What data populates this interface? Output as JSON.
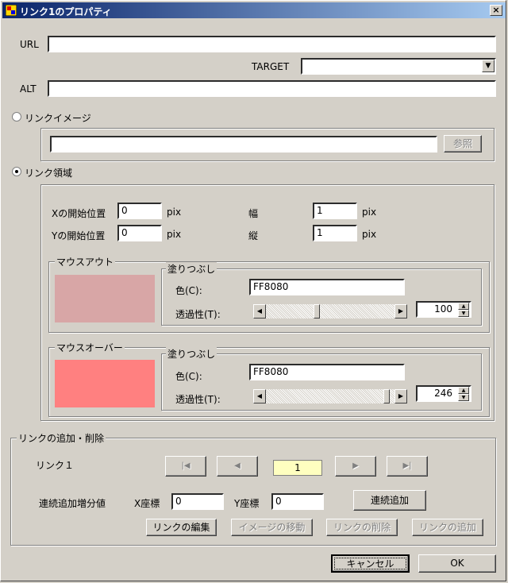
{
  "window": {
    "title": "リンク1のプロパティ",
    "close_glyph": "×"
  },
  "url": {
    "label": "URL",
    "value": ""
  },
  "target": {
    "label": "TARGET",
    "value": ""
  },
  "alt": {
    "label": "ALT",
    "value": ""
  },
  "link_image": {
    "radio_label": "リンクイメージ",
    "path": "",
    "browse_button": "参照"
  },
  "link_area": {
    "radio_label": "リンク領域",
    "x_label": "Xの開始位置",
    "x_value": "0",
    "x_unit": "pix",
    "y_label": "Yの開始位置",
    "y_value": "0",
    "y_unit": "pix",
    "w_label": "幅",
    "w_value": "1",
    "w_unit": "pix",
    "h_label": "縦",
    "h_value": "1",
    "h_unit": "pix"
  },
  "mouse_out": {
    "group_label": "マウスアウト",
    "fill_label": "塗りつぶし",
    "color_label": "色(C):",
    "color_value": "FF8080",
    "preview_color": "#d8a6a6",
    "opacity_label": "透過性(T):",
    "opacity_value": "100",
    "opacity_fraction": 0.39
  },
  "mouse_over": {
    "group_label": "マウスオーバー",
    "fill_label": "塗りつぶし",
    "color_label": "色(C):",
    "color_value": "FF8080",
    "preview_color": "#ff8080",
    "opacity_label": "透過性(T):",
    "opacity_value": "246",
    "opacity_fraction": 0.96
  },
  "links": {
    "group_label": "リンクの追加・削除",
    "link_label": "リンク１",
    "nav_first": "|◀",
    "nav_prev": "◀",
    "nav_next": "▶",
    "nav_last": "▶|",
    "current": "1",
    "increment_label": "連続追加増分値",
    "x_label": "X座標",
    "x_value": "0",
    "y_label": "Y座標",
    "y_value": "0",
    "continuous_add": "連続追加",
    "edit": "リンクの編集",
    "move_image": "イメージの移動",
    "delete": "リンクの削除",
    "add": "リンクの追加"
  },
  "footer": {
    "cancel": "キャンセル",
    "ok": "OK"
  }
}
